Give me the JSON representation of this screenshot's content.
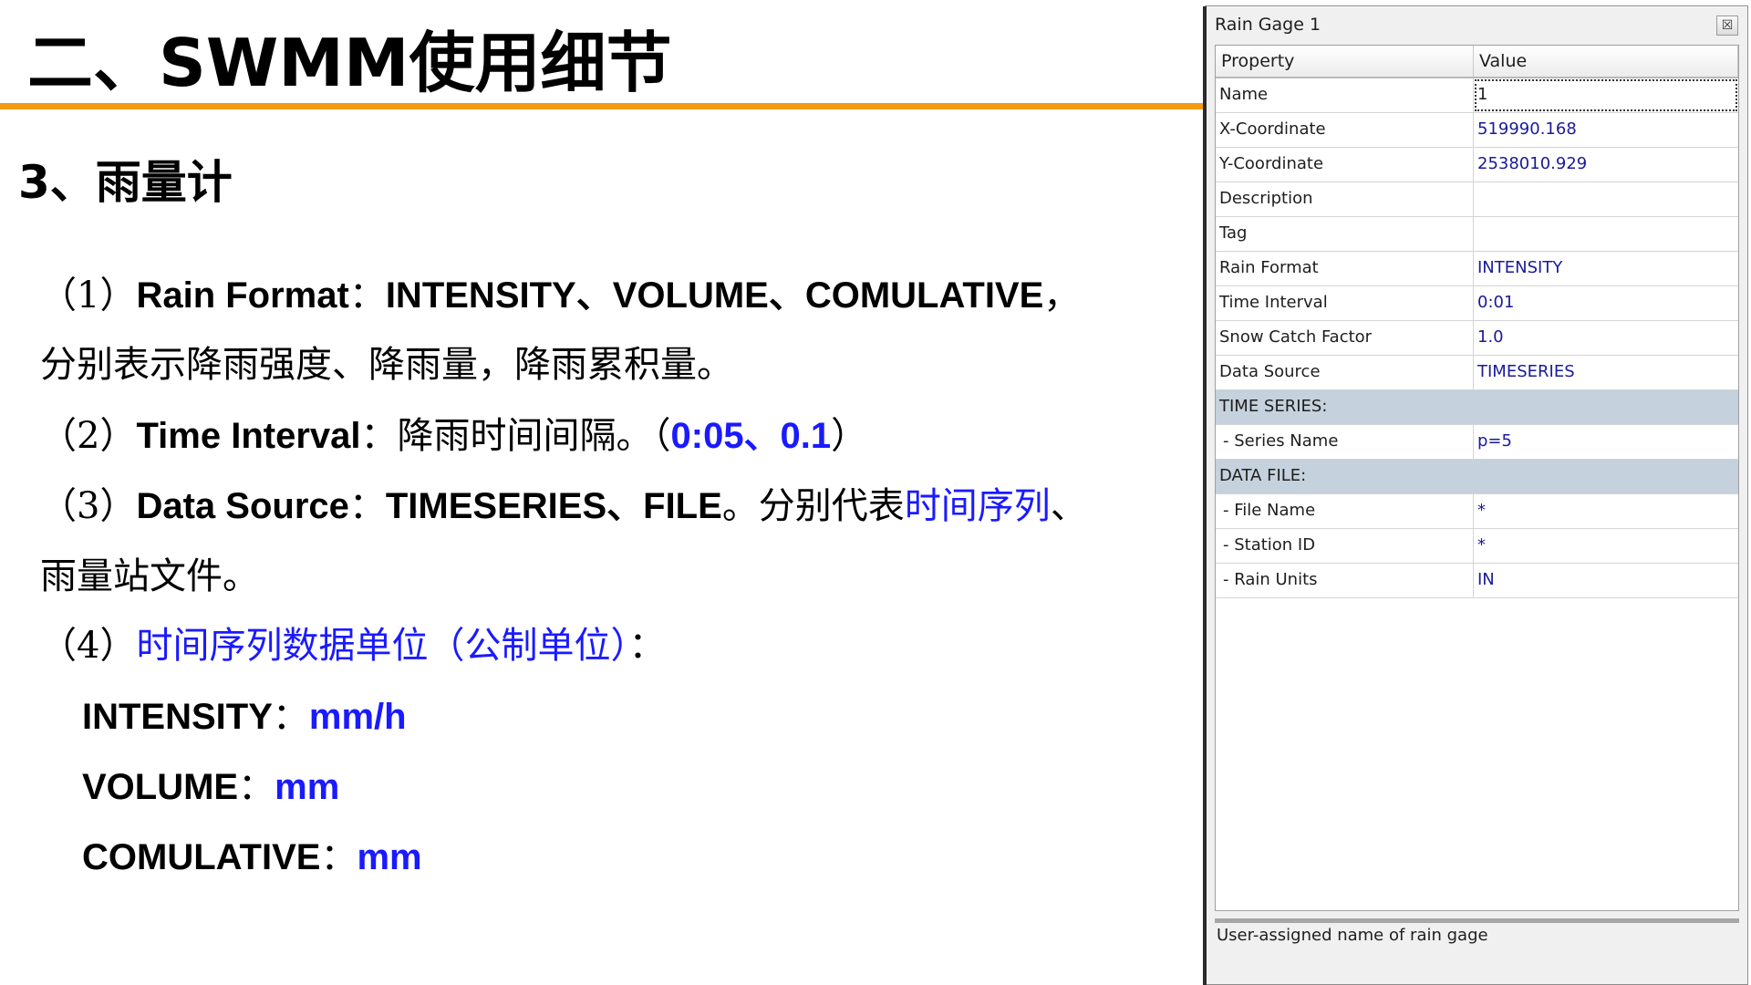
{
  "slide": {
    "title": "二、SWMM使用细节",
    "subtitle": "3、雨量计",
    "line1": {
      "prefix": "（1）",
      "label": "Rain Format",
      "colon": "：",
      "values": "INTENSITY、VOLUME、COMULATIVE",
      "tail": "，"
    },
    "line2": "分别表示降雨强度、降雨量，降雨累积量。",
    "line3": {
      "prefix": "（2）",
      "label": "Time Interval",
      "colon": "：",
      "text": "降雨时间间隔。（",
      "values": "0:05、0.1",
      "close": "）"
    },
    "line4": {
      "prefix": "（3）",
      "label": "Data Source",
      "colon": "：",
      "values": "TIMESERIES、FILE",
      "text": "。分别代表",
      "link": "时间序列",
      "tail": "、"
    },
    "line5": "雨量站文件。",
    "line6": {
      "prefix": "（4）",
      "text": "时间序列数据单位（公制单位）",
      "colon": "："
    },
    "units": [
      {
        "name": "INTENSITY",
        "colon": "：",
        "unit": "mm/h"
      },
      {
        "name": "VOLUME",
        "colon": "：",
        "unit": "mm"
      },
      {
        "name": "COMULATIVE",
        "colon": "：",
        "unit": "mm"
      }
    ]
  },
  "panel": {
    "title": "Rain Gage 1",
    "close_glyph": "☒",
    "header": {
      "property": "Property",
      "value": "Value"
    },
    "rows": [
      {
        "property": "Name",
        "value": "1"
      },
      {
        "property": "X-Coordinate",
        "value": "519990.168"
      },
      {
        "property": "Y-Coordinate",
        "value": "2538010.929"
      },
      {
        "property": "Description",
        "value": ""
      },
      {
        "property": "Tag",
        "value": ""
      },
      {
        "property": "Rain Format",
        "value": "INTENSITY"
      },
      {
        "property": "Time Interval",
        "value": "0:01"
      },
      {
        "property": "Snow Catch Factor",
        "value": "1.0"
      },
      {
        "property": "Data Source",
        "value": "TIMESERIES"
      },
      {
        "property": "TIME SERIES:",
        "value": ""
      },
      {
        "property": "- Series Name",
        "value": "p=5"
      },
      {
        "property": "DATA FILE:",
        "value": ""
      },
      {
        "property": "- File Name",
        "value": "*"
      },
      {
        "property": "- Station ID",
        "value": "*"
      },
      {
        "property": "- Rain Units",
        "value": "IN"
      }
    ],
    "description": "User-assigned name of rain gage"
  }
}
